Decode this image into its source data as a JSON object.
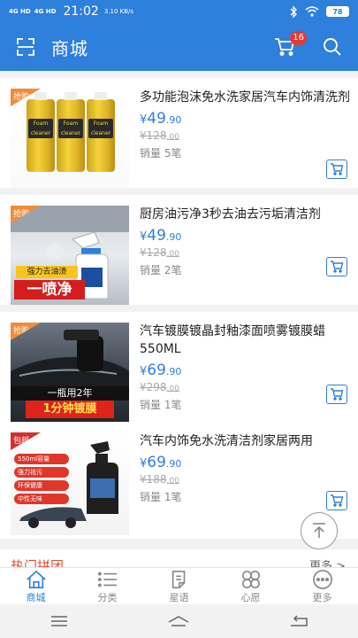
{
  "status_bar": {
    "signal1": "4G HD",
    "signal2": "4G HD",
    "time": "21:02",
    "speed": "3.10 KB/s",
    "battery": "78"
  },
  "header": {
    "title": "商城",
    "cart_badge": "16",
    "accent": "#2f7fdc"
  },
  "products": [
    {
      "tag": "抢购",
      "name": "多功能泡沫免水洗家居汽车内饰清洗剂",
      "price_int": "49",
      "price_dec": ".90",
      "old_int": "128",
      "old_dec": ".00",
      "sales": "销量 5笔"
    },
    {
      "tag": "抢购",
      "name": "厨房油污净3秒去油去污垢清洁剂",
      "price_int": "49",
      "price_dec": ".90",
      "old_int": "128",
      "old_dec": ".00",
      "sales": "销量 2笔",
      "promo1": "强力去油渍",
      "promo2": "一喷净"
    },
    {
      "tag": "抢购",
      "name": "汽车镀膜镀晶封釉漆面喷雾镀膜蜡550ML",
      "price_int": "69",
      "price_dec": ".90",
      "old_int": "298",
      "old_dec": ".00",
      "sales": "销量 1笔",
      "promo1": "一瓶用2年",
      "promo2": "1分钟镀膜"
    },
    {
      "tag": "包邮",
      "name": "汽车内饰免水洗清洁剂家居两用",
      "price_int": "69",
      "price_dec": ".90",
      "old_int": "188",
      "old_dec": ".00",
      "sales": "销量 1笔",
      "features": [
        "550ml容量",
        "强力祛污",
        "环保健康",
        "中性无味"
      ]
    }
  ],
  "currency": "¥",
  "section_peek": {
    "title": "热门拼团",
    "more": "更多 >"
  },
  "tabs": [
    {
      "label": "商城",
      "icon": "home-icon",
      "active": true
    },
    {
      "label": "分类",
      "icon": "list-icon",
      "active": false
    },
    {
      "label": "星语",
      "icon": "note-icon",
      "active": false
    },
    {
      "label": "心愿",
      "icon": "clover-icon",
      "active": false
    },
    {
      "label": "更多",
      "icon": "more-icon",
      "active": false
    }
  ]
}
